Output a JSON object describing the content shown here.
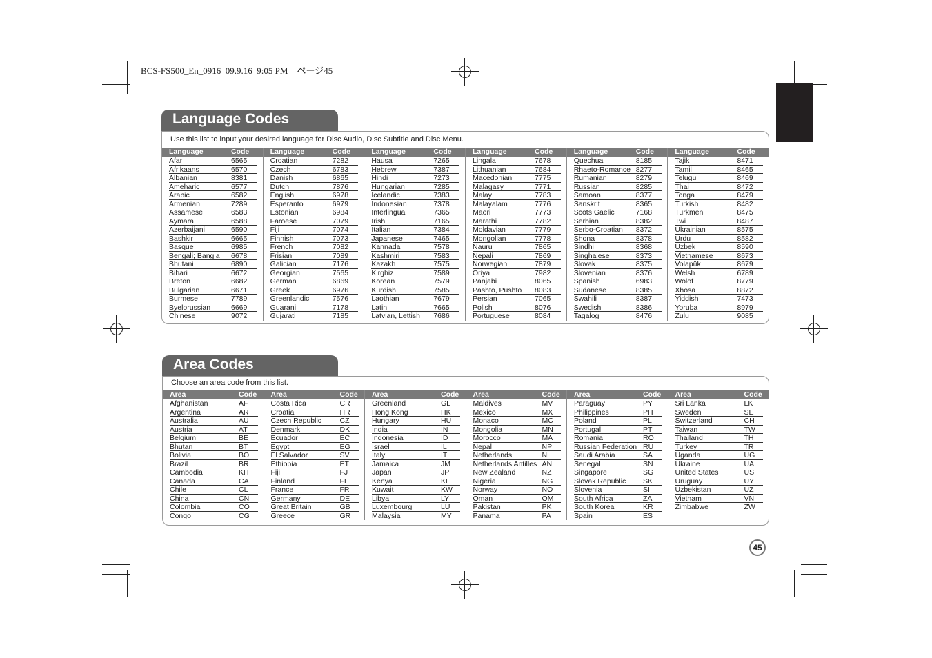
{
  "slug": "BCS-FS500_En_0916  09.9.16  9:05 PM    ページ45",
  "page_number": "45",
  "language_section": {
    "title": "Language Codes",
    "intro": "Use this list to input your desired language for Disc Audio, Disc Subtitle and Disc Menu.",
    "col_header_name": "Language",
    "col_header_code": "Code",
    "columns": [
      [
        [
          "Afar",
          "6565"
        ],
        [
          "Afrikaans",
          "6570"
        ],
        [
          "Albanian",
          "8381"
        ],
        [
          "Ameharic",
          "6577"
        ],
        [
          "Arabic",
          "6582"
        ],
        [
          "Armenian",
          "7289"
        ],
        [
          "Assamese",
          "6583"
        ],
        [
          "Aymara",
          "6588"
        ],
        [
          "Azerbaijani",
          "6590"
        ],
        [
          "Bashkir",
          "6665"
        ],
        [
          "Basque",
          "6985"
        ],
        [
          "Bengali; Bangla",
          "6678"
        ],
        [
          "Bhutani",
          "6890"
        ],
        [
          "Bihari",
          "6672"
        ],
        [
          "Breton",
          "6682"
        ],
        [
          "Bulgarian",
          "6671"
        ],
        [
          "Burmese",
          "7789"
        ],
        [
          "Byelorussian",
          "6669"
        ],
        [
          "Chinese",
          "9072"
        ]
      ],
      [
        [
          "Croatian",
          "7282"
        ],
        [
          "Czech",
          "6783"
        ],
        [
          "Danish",
          "6865"
        ],
        [
          "Dutch",
          "7876"
        ],
        [
          "English",
          "6978"
        ],
        [
          "Esperanto",
          "6979"
        ],
        [
          "Estonian",
          "6984"
        ],
        [
          "Faroese",
          "7079"
        ],
        [
          "Fiji",
          "7074"
        ],
        [
          "Finnish",
          "7073"
        ],
        [
          "French",
          "7082"
        ],
        [
          "Frisian",
          "7089"
        ],
        [
          "Galician",
          "7176"
        ],
        [
          "Georgian",
          "7565"
        ],
        [
          "German",
          "6869"
        ],
        [
          "Greek",
          "6976"
        ],
        [
          "Greenlandic",
          "7576"
        ],
        [
          "Guarani",
          "7178"
        ],
        [
          "Gujarati",
          "7185"
        ]
      ],
      [
        [
          "Hausa",
          "7265"
        ],
        [
          "Hebrew",
          "7387"
        ],
        [
          "Hindi",
          "7273"
        ],
        [
          "Hungarian",
          "7285"
        ],
        [
          "Icelandic",
          "7383"
        ],
        [
          "Indonesian",
          "7378"
        ],
        [
          "Interlingua",
          "7365"
        ],
        [
          "Irish",
          "7165"
        ],
        [
          "Italian",
          "7384"
        ],
        [
          "Japanese",
          "7465"
        ],
        [
          "Kannada",
          "7578"
        ],
        [
          "Kashmiri",
          "7583"
        ],
        [
          "Kazakh",
          "7575"
        ],
        [
          "Kirghiz",
          "7589"
        ],
        [
          "Korean",
          "7579"
        ],
        [
          "Kurdish",
          "7585"
        ],
        [
          "Laothian",
          "7679"
        ],
        [
          "Latin",
          "7665"
        ],
        [
          "Latvian, Lettish",
          "7686"
        ]
      ],
      [
        [
          "Lingala",
          "7678"
        ],
        [
          "Lithuanian",
          "7684"
        ],
        [
          "Macedonian",
          "7775"
        ],
        [
          "Malagasy",
          "7771"
        ],
        [
          "Malay",
          "7783"
        ],
        [
          "Malayalam",
          "7776"
        ],
        [
          "Maori",
          "7773"
        ],
        [
          "Marathi",
          "7782"
        ],
        [
          "Moldavian",
          "7779"
        ],
        [
          "Mongolian",
          "7778"
        ],
        [
          "Nauru",
          "7865"
        ],
        [
          "Nepali",
          "7869"
        ],
        [
          "Norwegian",
          "7879"
        ],
        [
          "Oriya",
          "7982"
        ],
        [
          "Panjabi",
          "8065"
        ],
        [
          "Pashto, Pushto",
          "8083"
        ],
        [
          "Persian",
          "7065"
        ],
        [
          "Polish",
          "8076"
        ],
        [
          "Portuguese",
          "8084"
        ]
      ],
      [
        [
          "Quechua",
          "8185"
        ],
        [
          "Rhaeto-Romance",
          "8277"
        ],
        [
          "Rumanian",
          "8279"
        ],
        [
          "Russian",
          "8285"
        ],
        [
          "Samoan",
          "8377"
        ],
        [
          "Sanskrit",
          "8365"
        ],
        [
          "Scots Gaelic",
          "7168"
        ],
        [
          "Serbian",
          "8382"
        ],
        [
          "Serbo-Croatian",
          "8372"
        ],
        [
          "Shona",
          "8378"
        ],
        [
          "Sindhi",
          "8368"
        ],
        [
          "Singhalese",
          "8373"
        ],
        [
          "Slovak",
          "8375"
        ],
        [
          "Slovenian",
          "8376"
        ],
        [
          "Spanish",
          "6983"
        ],
        [
          "Sudanese",
          "8385"
        ],
        [
          "Swahili",
          "8387"
        ],
        [
          "Swedish",
          "8386"
        ],
        [
          "Tagalog",
          "8476"
        ]
      ],
      [
        [
          "Tajik",
          "8471"
        ],
        [
          "Tamil",
          "8465"
        ],
        [
          "Telugu",
          "8469"
        ],
        [
          "Thai",
          "8472"
        ],
        [
          "Tonga",
          "8479"
        ],
        [
          "Turkish",
          "8482"
        ],
        [
          "Turkmen",
          "8475"
        ],
        [
          "Twi",
          "8487"
        ],
        [
          "Ukrainian",
          "8575"
        ],
        [
          "Urdu",
          "8582"
        ],
        [
          "Uzbek",
          "8590"
        ],
        [
          "Vietnamese",
          "8673"
        ],
        [
          "Volapük",
          "8679"
        ],
        [
          "Welsh",
          "6789"
        ],
        [
          "Wolof",
          "8779"
        ],
        [
          "Xhosa",
          "8872"
        ],
        [
          "Yiddish",
          "7473"
        ],
        [
          "Yoruba",
          "8979"
        ],
        [
          "Zulu",
          "9085"
        ]
      ]
    ]
  },
  "area_section": {
    "title": "Area Codes",
    "intro": "Choose an area code from this list.",
    "col_header_name": "Area",
    "col_header_code": "Code",
    "columns": [
      [
        [
          "Afghanistan",
          "AF"
        ],
        [
          "Argentina",
          "AR"
        ],
        [
          "Australia",
          "AU"
        ],
        [
          "Austria",
          "AT"
        ],
        [
          "Belgium",
          "BE"
        ],
        [
          "Bhutan",
          "BT"
        ],
        [
          "Bolivia",
          "BO"
        ],
        [
          "Brazil",
          "BR"
        ],
        [
          "Cambodia",
          "KH"
        ],
        [
          "Canada",
          "CA"
        ],
        [
          "Chile",
          "CL"
        ],
        [
          "China",
          "CN"
        ],
        [
          "Colombia",
          "CO"
        ],
        [
          "Congo",
          "CG"
        ]
      ],
      [
        [
          "Costa Rica",
          "CR"
        ],
        [
          "Croatia",
          "HR"
        ],
        [
          "Czech Republic",
          "CZ"
        ],
        [
          "Denmark",
          "DK"
        ],
        [
          "Ecuador",
          "EC"
        ],
        [
          "Egypt",
          "EG"
        ],
        [
          "El Salvador",
          "SV"
        ],
        [
          "Ethiopia",
          "ET"
        ],
        [
          "Fiji",
          "FJ"
        ],
        [
          "Finland",
          "FI"
        ],
        [
          "France",
          "FR"
        ],
        [
          "Germany",
          "DE"
        ],
        [
          "Great Britain",
          "GB"
        ],
        [
          "Greece",
          "GR"
        ]
      ],
      [
        [
          "Greenland",
          "GL"
        ],
        [
          "Hong Kong",
          "HK"
        ],
        [
          "Hungary",
          "HU"
        ],
        [
          "India",
          "IN"
        ],
        [
          "Indonesia",
          "ID"
        ],
        [
          "Israel",
          "IL"
        ],
        [
          "Italy",
          "IT"
        ],
        [
          "Jamaica",
          "JM"
        ],
        [
          "Japan",
          "JP"
        ],
        [
          "Kenya",
          "KE"
        ],
        [
          "Kuwait",
          "KW"
        ],
        [
          "Libya",
          "LY"
        ],
        [
          "Luxembourg",
          "LU"
        ],
        [
          "Malaysia",
          "MY"
        ]
      ],
      [
        [
          "Maldives",
          "MV"
        ],
        [
          "Mexico",
          "MX"
        ],
        [
          "Monaco",
          "MC"
        ],
        [
          "Mongolia",
          "MN"
        ],
        [
          "Morocco",
          "MA"
        ],
        [
          "Nepal",
          "NP"
        ],
        [
          "Netherlands",
          "NL"
        ],
        [
          "Netherlands Antilles",
          "AN"
        ],
        [
          "New Zealand",
          "NZ"
        ],
        [
          "Nigeria",
          "NG"
        ],
        [
          "Norway",
          "NO"
        ],
        [
          "Oman",
          "OM"
        ],
        [
          "Pakistan",
          "PK"
        ],
        [
          "Panama",
          "PA"
        ]
      ],
      [
        [
          "Paraguay",
          "PY"
        ],
        [
          "Philippines",
          "PH"
        ],
        [
          "Poland",
          "PL"
        ],
        [
          "Portugal",
          "PT"
        ],
        [
          "Romania",
          "RO"
        ],
        [
          "Russian Federation",
          "RU"
        ],
        [
          "Saudi Arabia",
          "SA"
        ],
        [
          "Senegal",
          "SN"
        ],
        [
          "Singapore",
          "SG"
        ],
        [
          "Slovak Republic",
          "SK"
        ],
        [
          "Slovenia",
          "SI"
        ],
        [
          "South Africa",
          "ZA"
        ],
        [
          "South Korea",
          "KR"
        ],
        [
          "Spain",
          "ES"
        ]
      ],
      [
        [
          "Sri Lanka",
          "LK"
        ],
        [
          "Sweden",
          "SE"
        ],
        [
          "Switzerland",
          "CH"
        ],
        [
          "Taiwan",
          "TW"
        ],
        [
          "Thailand",
          "TH"
        ],
        [
          "Turkey",
          "TR"
        ],
        [
          "Uganda",
          "UG"
        ],
        [
          "Ukraine",
          "UA"
        ],
        [
          "United States",
          "US"
        ],
        [
          "Uruguay",
          "UY"
        ],
        [
          "Uzbekistan",
          "UZ"
        ],
        [
          "Vietnam",
          "VN"
        ],
        [
          "Zimbabwe",
          "ZW"
        ]
      ]
    ]
  }
}
